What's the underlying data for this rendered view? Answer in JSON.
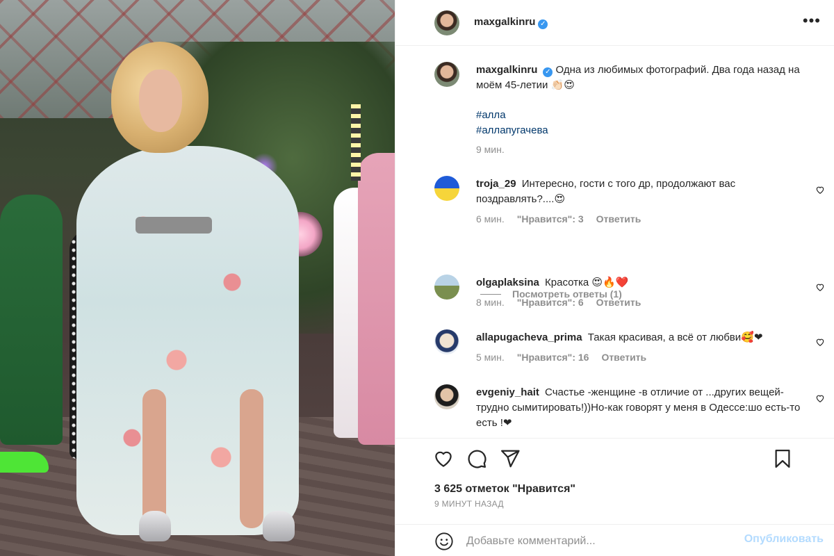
{
  "post": {
    "author": "maxgalkinru",
    "caption": "Одна из любимых фотографий. Два года назад на моём 45-летии 👏🏻😍",
    "hashtags": [
      "#алла",
      "#аллапугачева"
    ],
    "caption_time": "9 мин."
  },
  "icons": {
    "verified": "verified-badge-icon",
    "more": "more-options-icon",
    "like": "heart-icon",
    "comment": "comment-bubble-icon",
    "share": "paper-plane-icon",
    "save": "bookmark-icon",
    "emoji": "emoji-icon"
  },
  "comments": [
    {
      "username": "troja_29",
      "text": "Интересно, гости с того др, продолжают вас поздравлять?....😍",
      "time": "6 мин.",
      "likes": "\"Нравится\": 3",
      "reply": "Ответить"
    },
    {
      "username": "olgaplaksina",
      "text": "Красотка 😍🔥❤️",
      "time": "8 мин.",
      "likes": "\"Нравится\": 6",
      "reply": "Ответить"
    },
    {
      "username": "allapugacheva_prima",
      "text": "Такая красивая, а всё от любви🥰❤",
      "time": "5 мин.",
      "likes": "\"Нравится\": 16",
      "reply": "Ответить"
    },
    {
      "username": "evgeniy_hait",
      "text": "Счастье -женщине -в отличие от ...других вещей-трудно сымитировать!))Но-как говорят у меня в Одессе:шо есть-то есть !❤"
    }
  ],
  "view_replies": "Посмотреть ответы (1)",
  "likes_total": "3 625 отметок \"Нравится\"",
  "posted_ago": "9 МИНУТ НАЗАД",
  "comment_input": {
    "placeholder": "Добавьте комментарий...",
    "value": ""
  },
  "post_button": "Опубликовать",
  "colors": {
    "text": "#262626",
    "secondary": "#8e8e8e",
    "hashtag": "#00376b",
    "verified": "#3897f0",
    "post_button_disabled": "#b3dbff",
    "divider": "#efefef"
  }
}
